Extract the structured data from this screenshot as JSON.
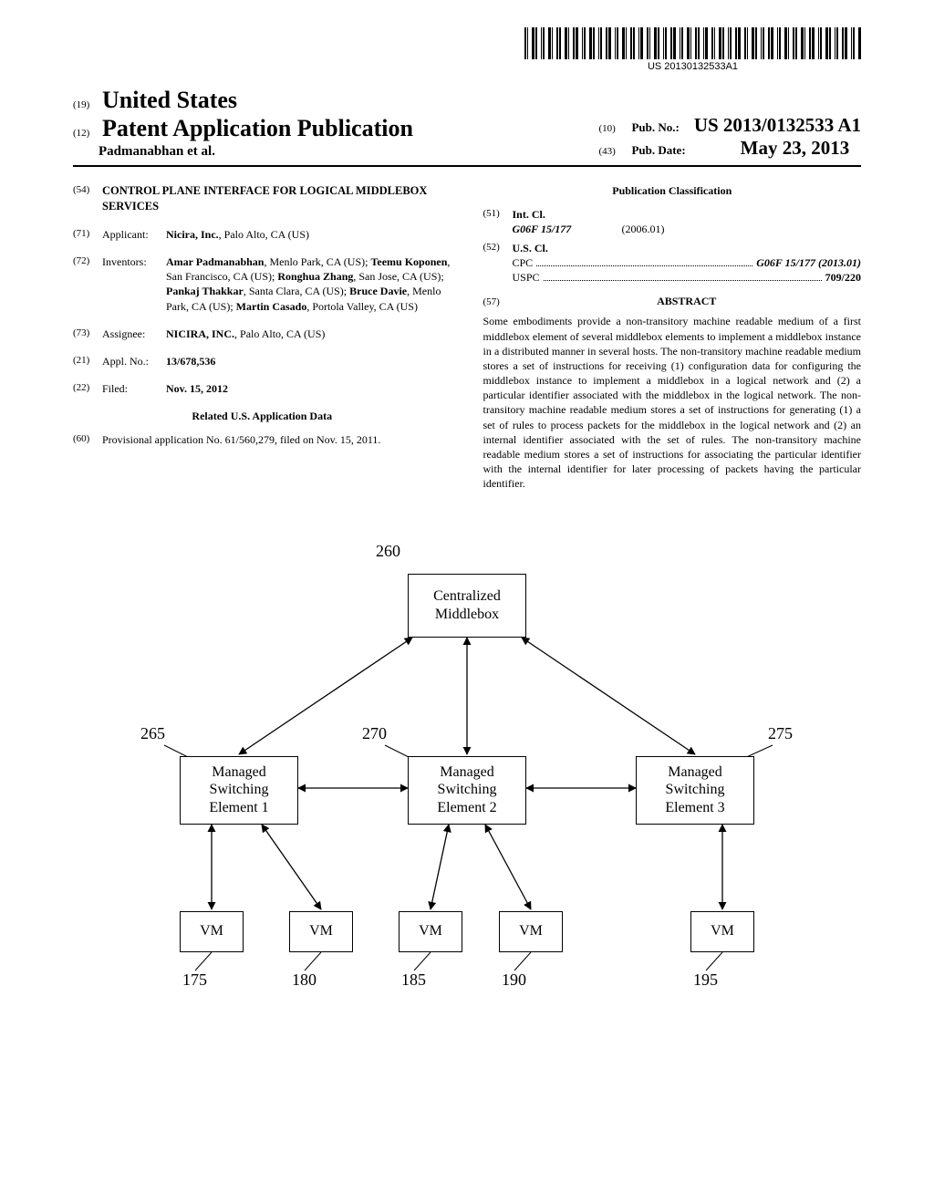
{
  "barcode_text": "US 20130132533A1",
  "header": {
    "inid_19": "(19)",
    "country": "United States",
    "inid_12": "(12)",
    "pub_title": "Patent Application Publication",
    "authors": "Padmanabhan et al.",
    "inid_10": "(10)",
    "pub_no_label": "Pub. No.:",
    "pub_no_value": "US 2013/0132533 A1",
    "inid_43": "(43)",
    "pub_date_label": "Pub. Date:",
    "pub_date_value": "May 23, 2013"
  },
  "left": {
    "f54": {
      "inid": "(54)",
      "title": "CONTROL PLANE INTERFACE FOR LOGICAL MIDDLEBOX SERVICES"
    },
    "f71": {
      "inid": "(71)",
      "label": "Applicant:",
      "content": "Nicira, Inc., Palo Alto, CA (US)"
    },
    "f72": {
      "inid": "(72)",
      "label": "Inventors:",
      "content": "Amar Padmanabhan, Menlo Park, CA (US); Teemu Koponen, San Francisco, CA (US); Ronghua Zhang, San Jose, CA (US); Pankaj Thakkar, Santa Clara, CA (US); Bruce Davie, Menlo Park, CA (US); Martin Casado, Portola Valley, CA (US)"
    },
    "f73": {
      "inid": "(73)",
      "label": "Assignee:",
      "content": "NICIRA, INC., Palo Alto, CA (US)"
    },
    "f21": {
      "inid": "(21)",
      "label": "Appl. No.:",
      "content": "13/678,536"
    },
    "f22": {
      "inid": "(22)",
      "label": "Filed:",
      "content": "Nov. 15, 2012"
    },
    "related_heading": "Related U.S. Application Data",
    "f60": {
      "inid": "(60)",
      "content": "Provisional application No. 61/560,279, filed on Nov. 15, 2011."
    }
  },
  "right": {
    "classification_heading": "Publication Classification",
    "f51": {
      "inid": "(51)",
      "label": "Int. Cl.",
      "code": "G06F 15/177",
      "date": "(2006.01)"
    },
    "f52": {
      "inid": "(52)",
      "label": "U.S. Cl.",
      "cpc_label": "CPC",
      "cpc_value": "G06F 15/177 (2013.01)",
      "uspc_label": "USPC",
      "uspc_value": "709/220"
    },
    "f57": {
      "inid": "(57)",
      "heading": "ABSTRACT"
    },
    "abstract": "Some embodiments provide a non-transitory machine readable medium of a first middlebox element of several middlebox elements to implement a middlebox instance in a distributed manner in several hosts. The non-transitory machine readable medium stores a set of instructions for receiving (1) configuration data for configuring the middlebox instance to implement a middlebox in a logical network and (2) a particular identifier associated with the middlebox in the logical network. The non-transitory machine readable medium stores a set of instructions for generating (1) a set of rules to process packets for the middlebox in the logical network and (2) an internal identifier associated with the set of rules. The non-transitory machine readable medium stores a set of instructions for associating the particular identifier with the internal identifier for later processing of packets having the particular identifier."
  },
  "diagram": {
    "central": "Centralized\nMiddlebox",
    "mse1": "Managed\nSwitching\nElement 1",
    "mse2": "Managed\nSwitching\nElement 2",
    "mse3": "Managed\nSwitching\nElement 3",
    "vm": "VM",
    "r260": "260",
    "r265": "265",
    "r270": "270",
    "r275": "275",
    "r175": "175",
    "r180": "180",
    "r185": "185",
    "r190": "190",
    "r195": "195"
  }
}
